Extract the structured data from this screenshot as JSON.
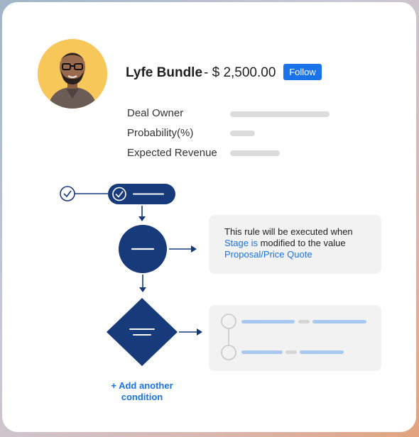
{
  "deal": {
    "name": "Lyfe Bundle",
    "price": "- $ 2,500.00",
    "follow_label": "Follow"
  },
  "fields": [
    {
      "label": "Deal Owner"
    },
    {
      "label": "Probability(%)"
    },
    {
      "label": "Expected Revenue"
    }
  ],
  "rule": {
    "line1": "This rule will be executed when",
    "line2_field": "Stage is",
    "line2_rest": " modified to the value",
    "line3_value": "Proposal/Price Quote"
  },
  "add_condition": {
    "line1": "+ Add another",
    "line2": "condition"
  },
  "colors": {
    "accent": "#1a73e8",
    "flow_navy": "#173a7a",
    "avatar_bg": "#f7c75a",
    "light_blue_bar": "#a9c8f0"
  },
  "icons": {
    "check": "check-circle-icon",
    "node_check": "check-icon",
    "arrows": "arrow-icon"
  }
}
